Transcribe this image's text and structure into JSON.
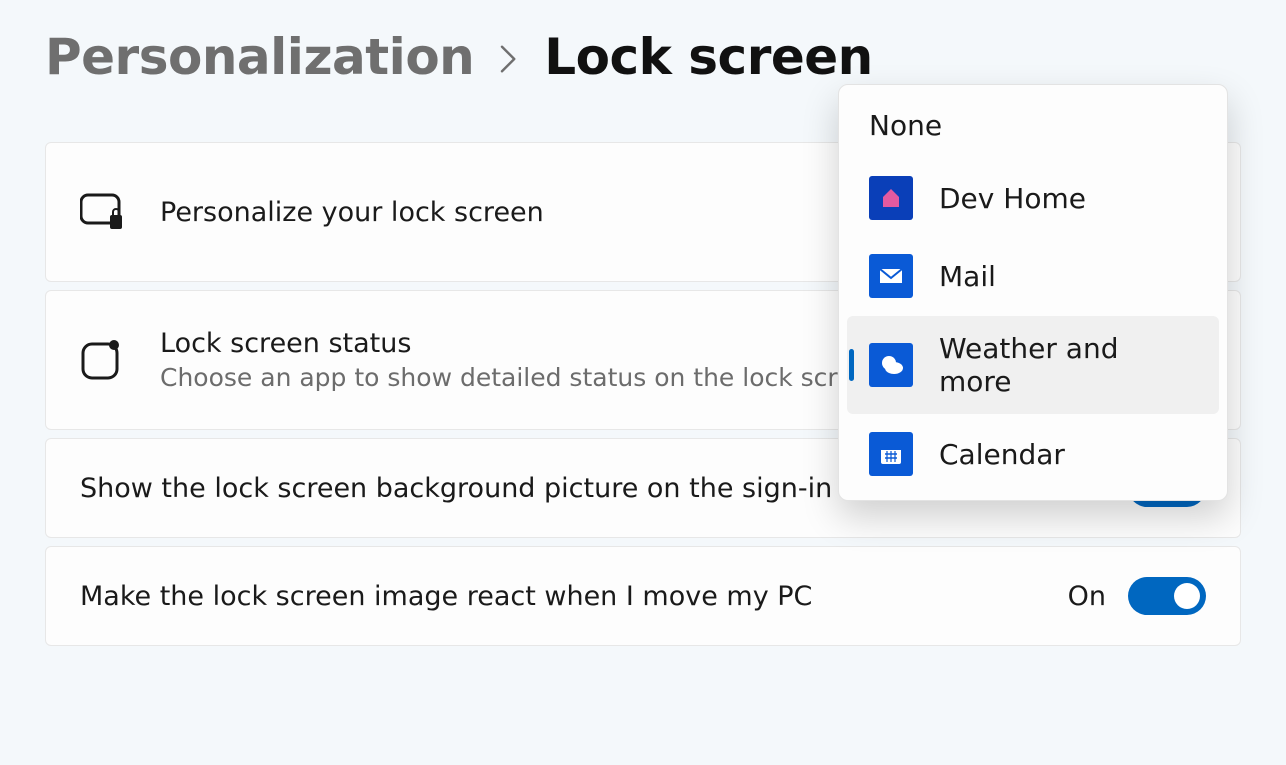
{
  "breadcrumb": {
    "parent": "Personalization",
    "current": "Lock screen"
  },
  "rows": {
    "personalize": {
      "title": "Personalize your lock screen"
    },
    "status": {
      "title": "Lock screen status",
      "subtitle": "Choose an app to show detailed status on the lock screen"
    },
    "bgOnSignin": {
      "label": "Show the lock screen background picture on the sign-in screen",
      "state": "On"
    },
    "reactMove": {
      "label": "Make the lock screen image react when I move my PC",
      "state": "On"
    }
  },
  "flyout": {
    "items": [
      {
        "label": "None"
      },
      {
        "label": "Dev Home"
      },
      {
        "label": "Mail"
      },
      {
        "label": "Weather and more"
      },
      {
        "label": "Calendar"
      }
    ],
    "selectedIndex": 3
  },
  "colors": {
    "accent": "#0067c0"
  }
}
